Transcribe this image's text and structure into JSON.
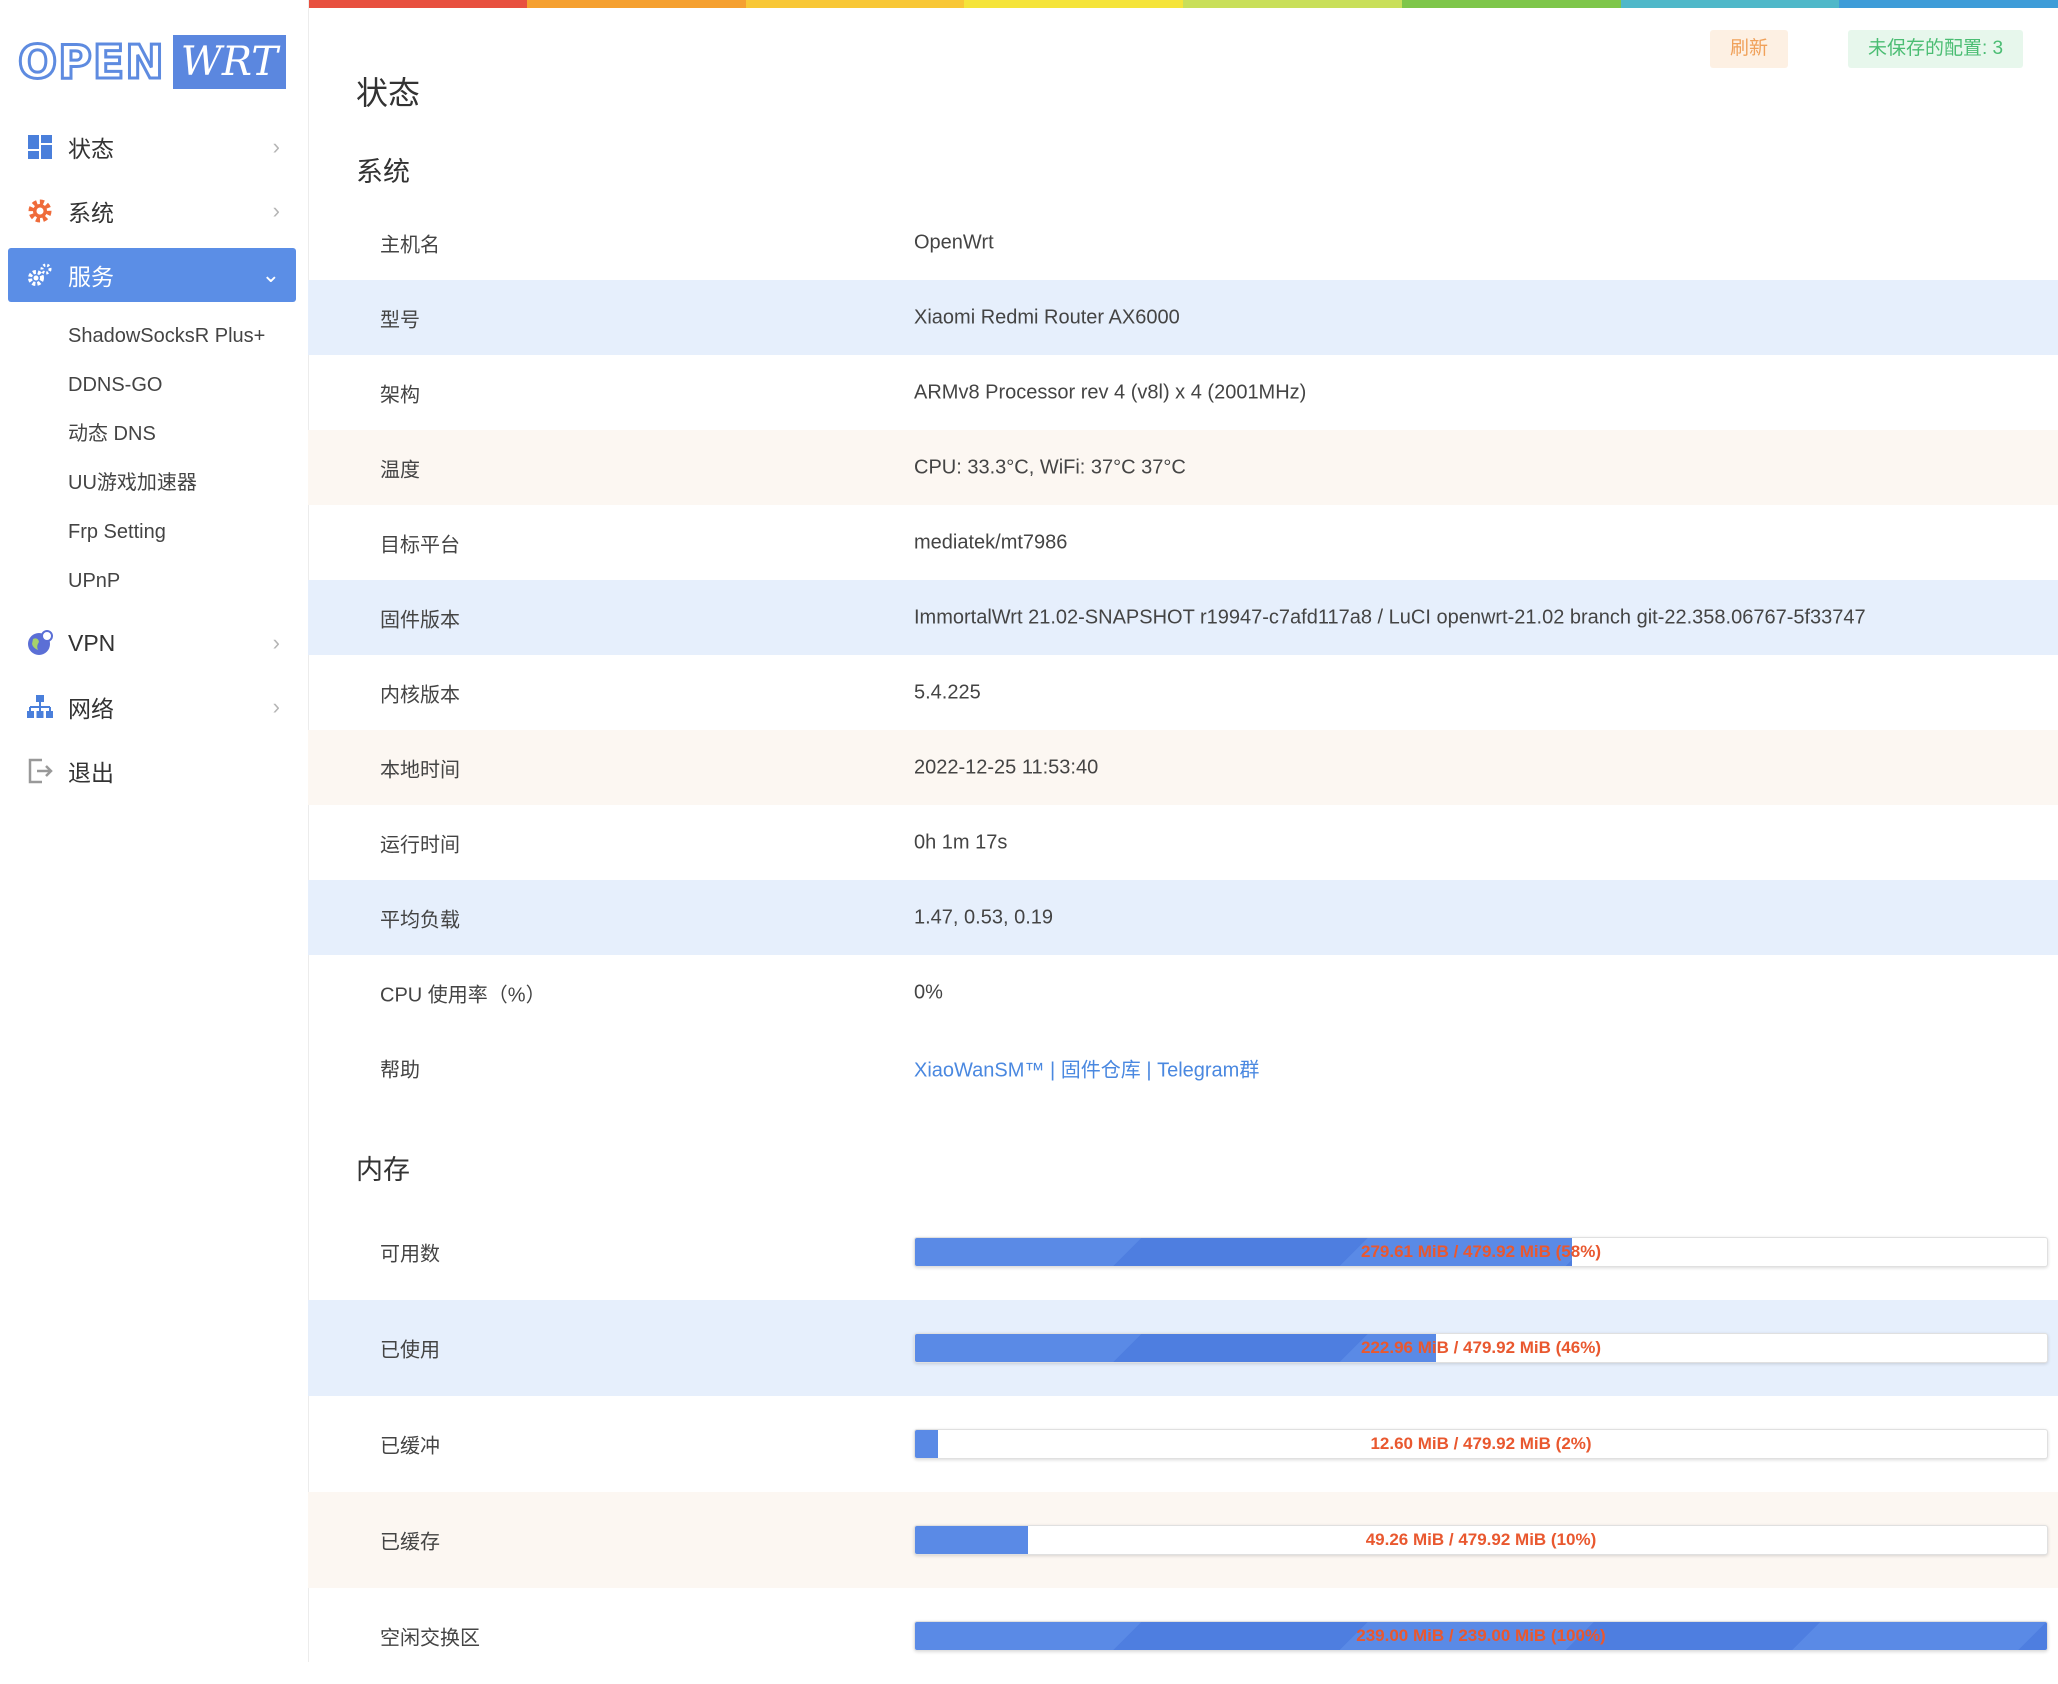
{
  "colors": {
    "rainbow": [
      "#e8503f",
      "#f5a030",
      "#f8c736",
      "#f5e43a",
      "#c9df5a",
      "#7ec64a",
      "#4fb8c9",
      "#3e9cd8"
    ],
    "accent": "#5b8ee6",
    "row_blue": "#e6effc",
    "row_peach": "#fcf7f2",
    "bar_text": "#e9582f"
  },
  "logo": {
    "open": "OPEN",
    "wrt": "WRT"
  },
  "sidebar": {
    "items": [
      {
        "label": "状态",
        "icon": "dashboard-icon"
      },
      {
        "label": "系统",
        "icon": "gear-icon"
      },
      {
        "label": "服务",
        "icon": "gears-icon",
        "active": true
      },
      {
        "label": "VPN",
        "icon": "globe-icon"
      },
      {
        "label": "网络",
        "icon": "network-icon"
      },
      {
        "label": "退出",
        "icon": "logout-icon"
      }
    ],
    "submenu": [
      "ShadowSocksR Plus+",
      "DDNS-GO",
      "动态 DNS",
      "UU游戏加速器",
      "Frp Setting",
      "UPnP"
    ]
  },
  "header": {
    "refresh_label": "刷新",
    "unsaved_label": "未保存的配置: 3"
  },
  "page": {
    "title": "状态"
  },
  "system": {
    "title": "系统",
    "rows": [
      {
        "key": "主机名",
        "value": "OpenWrt"
      },
      {
        "key": "型号",
        "value": "Xiaomi Redmi Router AX6000"
      },
      {
        "key": "架构",
        "value": "ARMv8 Processor rev 4 (v8l) x 4 (2001MHz)"
      },
      {
        "key": "温度",
        "value": "CPU: 33.3°C, WiFi: 37°C 37°C"
      },
      {
        "key": "目标平台",
        "value": "mediatek/mt7986"
      },
      {
        "key": "固件版本",
        "value": "ImmortalWrt 21.02-SNAPSHOT r19947-c7afd117a8 / LuCI openwrt-21.02 branch git-22.358.06767-5f33747"
      },
      {
        "key": "内核版本",
        "value": "5.4.225"
      },
      {
        "key": "本地时间",
        "value": "2022-12-25 11:53:40"
      },
      {
        "key": "运行时间",
        "value": "0h 1m 17s"
      },
      {
        "key": "平均负载",
        "value": "1.47, 0.53, 0.19"
      },
      {
        "key": "CPU 使用率（%）",
        "value": "0%"
      }
    ],
    "help": {
      "key": "帮助",
      "links": [
        "XiaoWanSM™",
        "| 固件仓库",
        "| Telegram群"
      ]
    }
  },
  "memory": {
    "title": "内存",
    "rows": [
      {
        "key": "可用数",
        "text": "279.61 MiB / 479.92 MiB (58%)",
        "percent": 58
      },
      {
        "key": "已使用",
        "text": "222.96 MiB / 479.92 MiB (46%)",
        "percent": 46
      },
      {
        "key": "已缓冲",
        "text": "12.60 MiB / 479.92 MiB (2%)",
        "percent": 2
      },
      {
        "key": "已缓存",
        "text": "49.26 MiB / 479.92 MiB (10%)",
        "percent": 10
      },
      {
        "key": "空闲交换区",
        "text": "239.00 MiB / 239.00 MiB (100%)",
        "percent": 100
      }
    ]
  }
}
